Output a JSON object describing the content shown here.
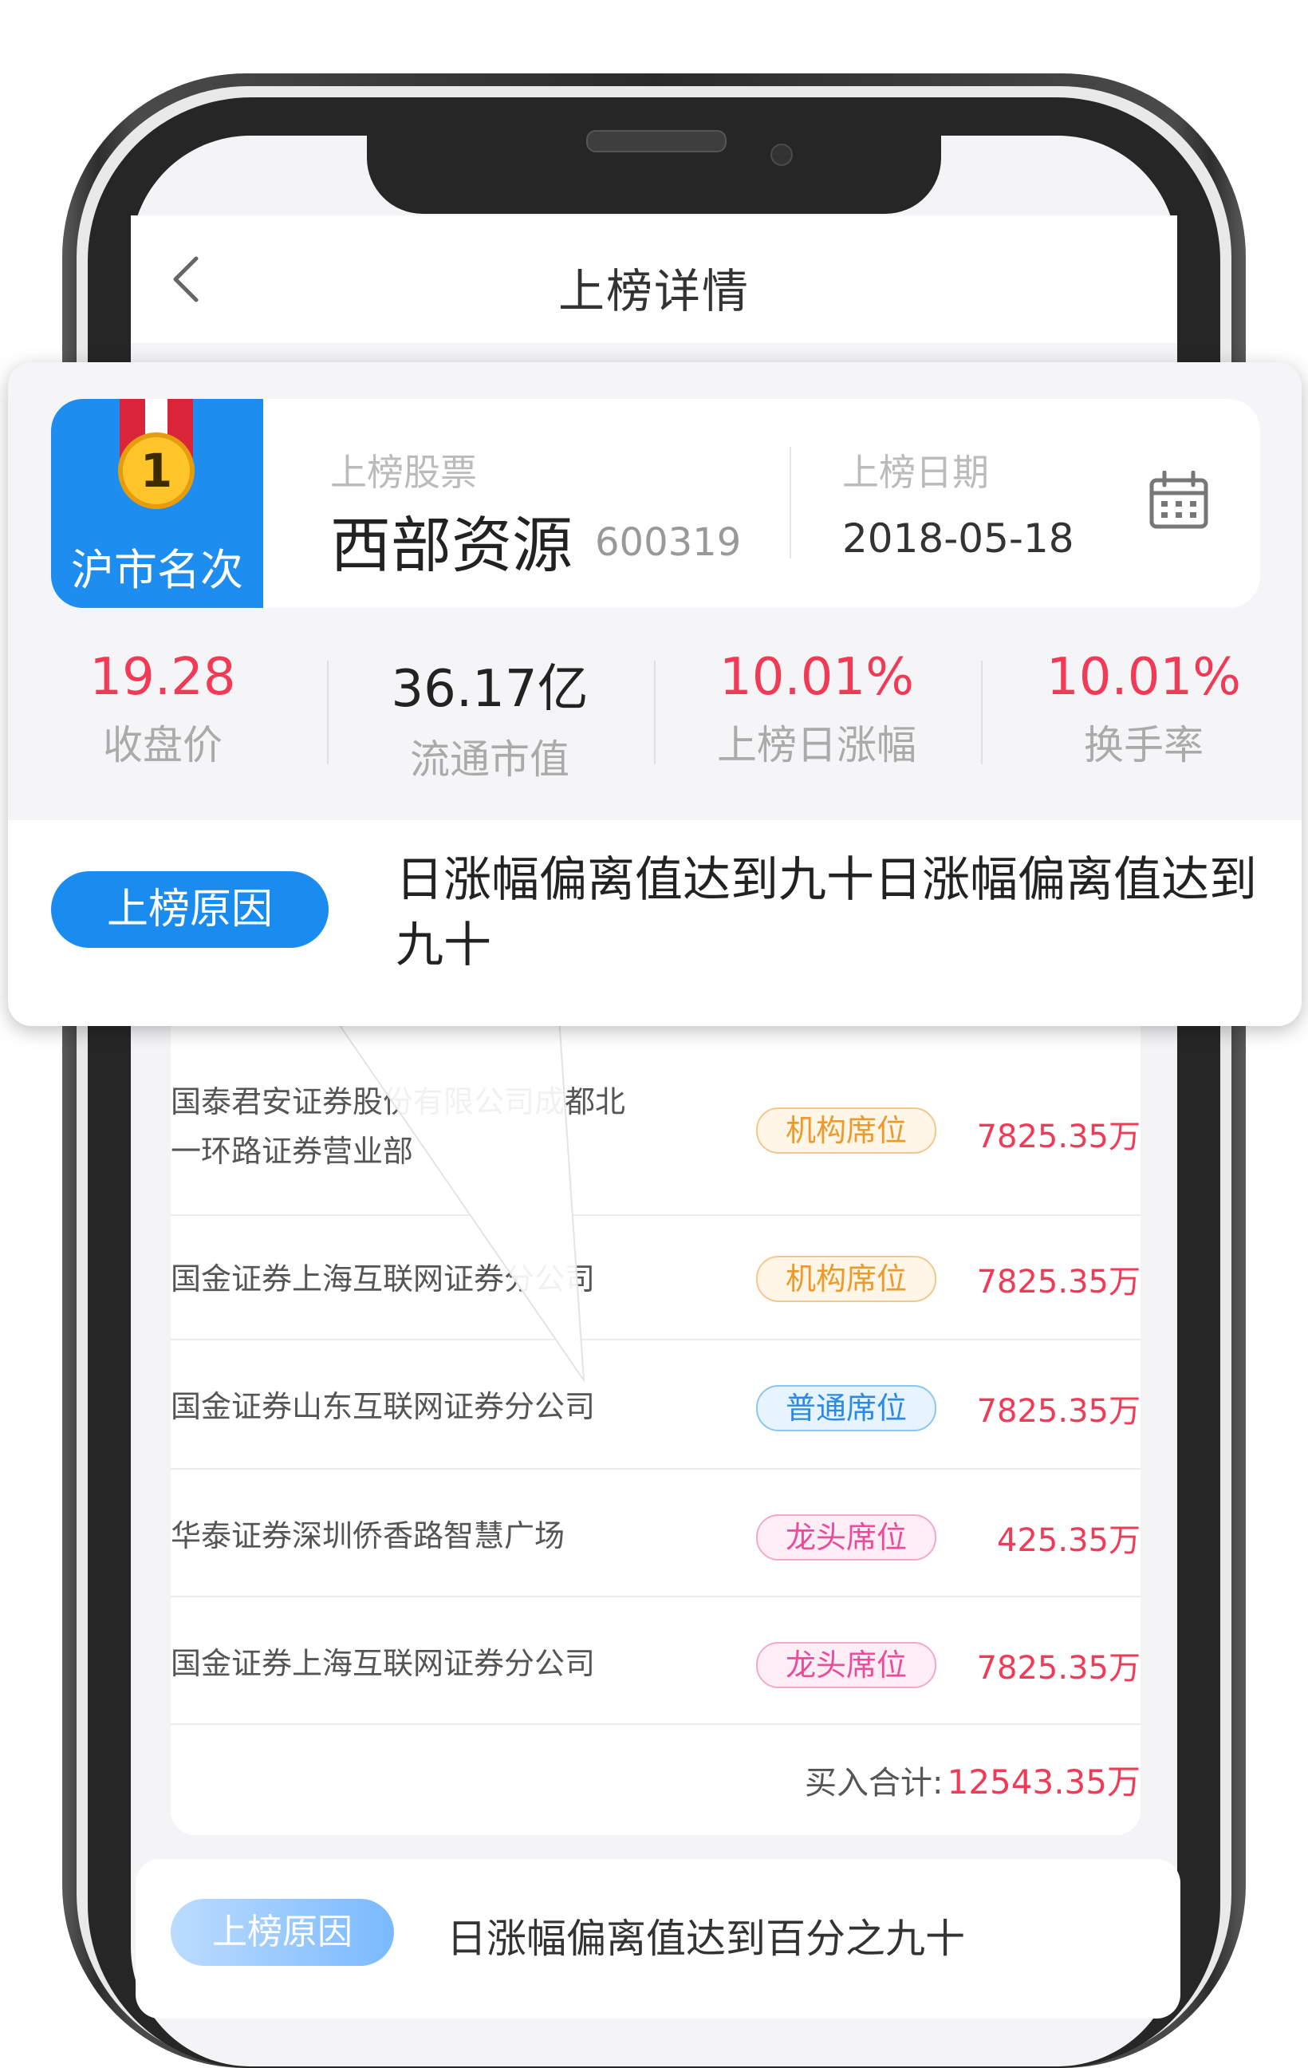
{
  "header": {
    "title": "上榜详情",
    "back_icon": "chevron-left-icon"
  },
  "rank": {
    "number": "1",
    "label": "沪市名次",
    "badge_color": "#1d8ef0"
  },
  "stock": {
    "label": "上榜股票",
    "name": "西部资源",
    "code": "600319"
  },
  "date": {
    "label": "上榜日期",
    "value": "2018-05-18",
    "icon": "calendar-icon"
  },
  "stats": [
    {
      "value": "19.28",
      "label": "收盘价",
      "color": "#f03a56"
    },
    {
      "value": "36.17亿",
      "label": "流通市值",
      "color": "#222222"
    },
    {
      "value": "10.01%",
      "label": "上榜日涨幅",
      "color": "#f03a56"
    },
    {
      "value": "10.01%",
      "label": "换手率",
      "color": "#f03a56"
    }
  ],
  "reason": {
    "pill": "上榜原因",
    "text": "日涨幅偏离值达到九十日涨幅偏离值达到九十"
  },
  "seats": [
    {
      "name_line1": "国泰君安证券股份有限公司成都北",
      "name_line2": "一环路证券营业部",
      "tag": "机构席位",
      "amount": "7825.35万"
    },
    {
      "name_line1": "国金证券上海互联网证券分公司",
      "tag": "机构席位",
      "amount": "7825.35万"
    },
    {
      "name_line1": "国金证券山东互联网证券分公司",
      "tag": "普通席位",
      "amount": "7825.35万"
    },
    {
      "name_line1": "华泰证券深圳侨香路智慧广场",
      "tag": "龙头席位",
      "amount": "425.35万"
    },
    {
      "name_line1": "国金证券上海互联网证券分公司",
      "tag": "龙头席位",
      "amount": "7825.35万"
    }
  ],
  "total": {
    "label": "买入合计:",
    "value": "12543.35万"
  },
  "reason2": {
    "pill": "上榜原因",
    "text": "日涨幅偏离值达到百分之九十"
  },
  "colors": {
    "accent_blue": "#1a8cf0",
    "amount_red": "#f03a56",
    "tag_institution": "#ee9a2b",
    "tag_normal": "#2b8ae6",
    "tag_leader": "#ec4a9a"
  }
}
